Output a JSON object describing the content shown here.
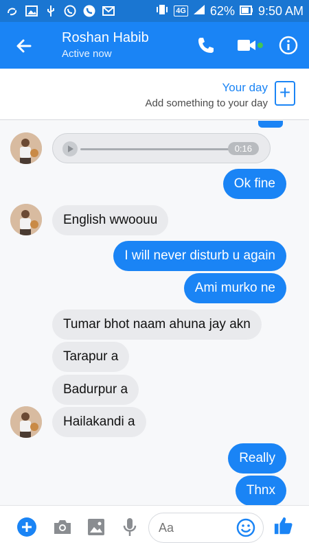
{
  "status_bar": {
    "network": "4G",
    "battery": "62%",
    "time": "9:50 AM"
  },
  "header": {
    "contact_name": "Roshan Habib",
    "status": "Active now"
  },
  "your_day": {
    "title": "Your day",
    "subtitle": "Add something to your day"
  },
  "audio": {
    "duration": "0:16"
  },
  "messages": [
    {
      "text": "Ok fine"
    },
    {
      "text": "English wwoouu"
    },
    {
      "text": "I will never disturb u again"
    },
    {
      "text": "Ami murko ne"
    },
    {
      "text": "Tumar bhot naam ahuna jay akn"
    },
    {
      "text": "Tarapur a"
    },
    {
      "text": "Badurpur a"
    },
    {
      "text": "Hailakandi a"
    },
    {
      "text": "Really"
    },
    {
      "text": "Thnx"
    }
  ],
  "composer": {
    "placeholder": "Aa"
  },
  "colors": {
    "brand_blue": "#1a84f5",
    "incoming_bubble": "#e9eaed",
    "online_dot": "#44c553"
  }
}
